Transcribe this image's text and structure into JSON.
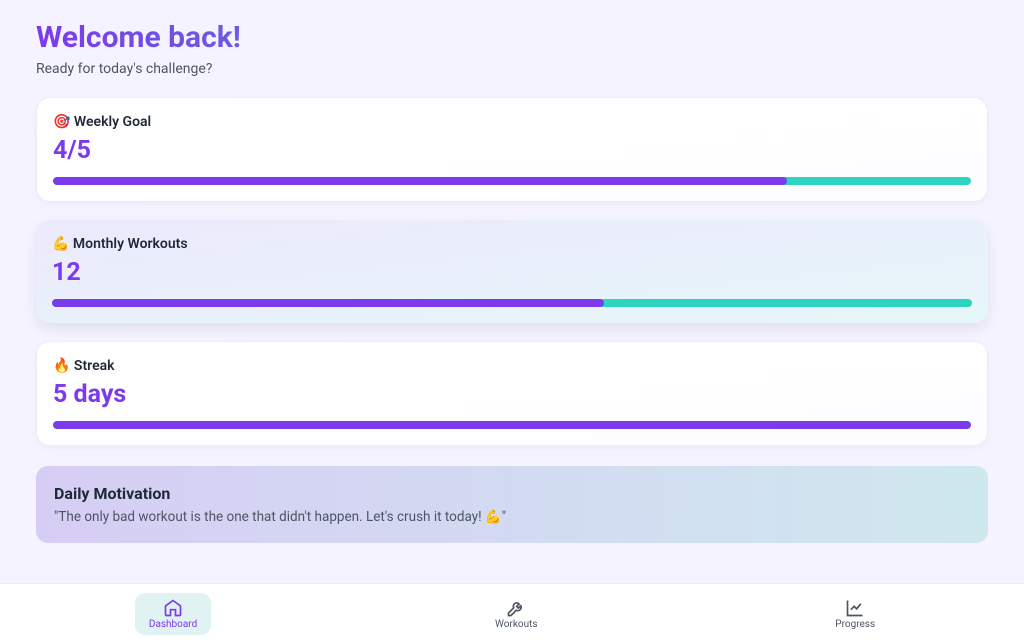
{
  "header": {
    "title": "Welcome back!",
    "subtitle": "Ready for today's challenge?"
  },
  "stats": [
    {
      "icon": "🎯",
      "label": "Weekly Goal",
      "value": "4/5",
      "progress": 80,
      "highlight": false
    },
    {
      "icon": "💪",
      "label": "Monthly Workouts",
      "value": "12",
      "progress": 60,
      "highlight": true
    },
    {
      "icon": "🔥",
      "label": "Streak",
      "value": "5 days",
      "progress": 100,
      "highlight": false
    }
  ],
  "motivation": {
    "title": "Daily Motivation",
    "text": "\"The only bad workout is the one that didn't happen. Let's crush it today! 💪\""
  },
  "nav": {
    "dashboard": "Dashboard",
    "workouts": "Workouts",
    "progress": "Progress",
    "active": "dashboard"
  }
}
